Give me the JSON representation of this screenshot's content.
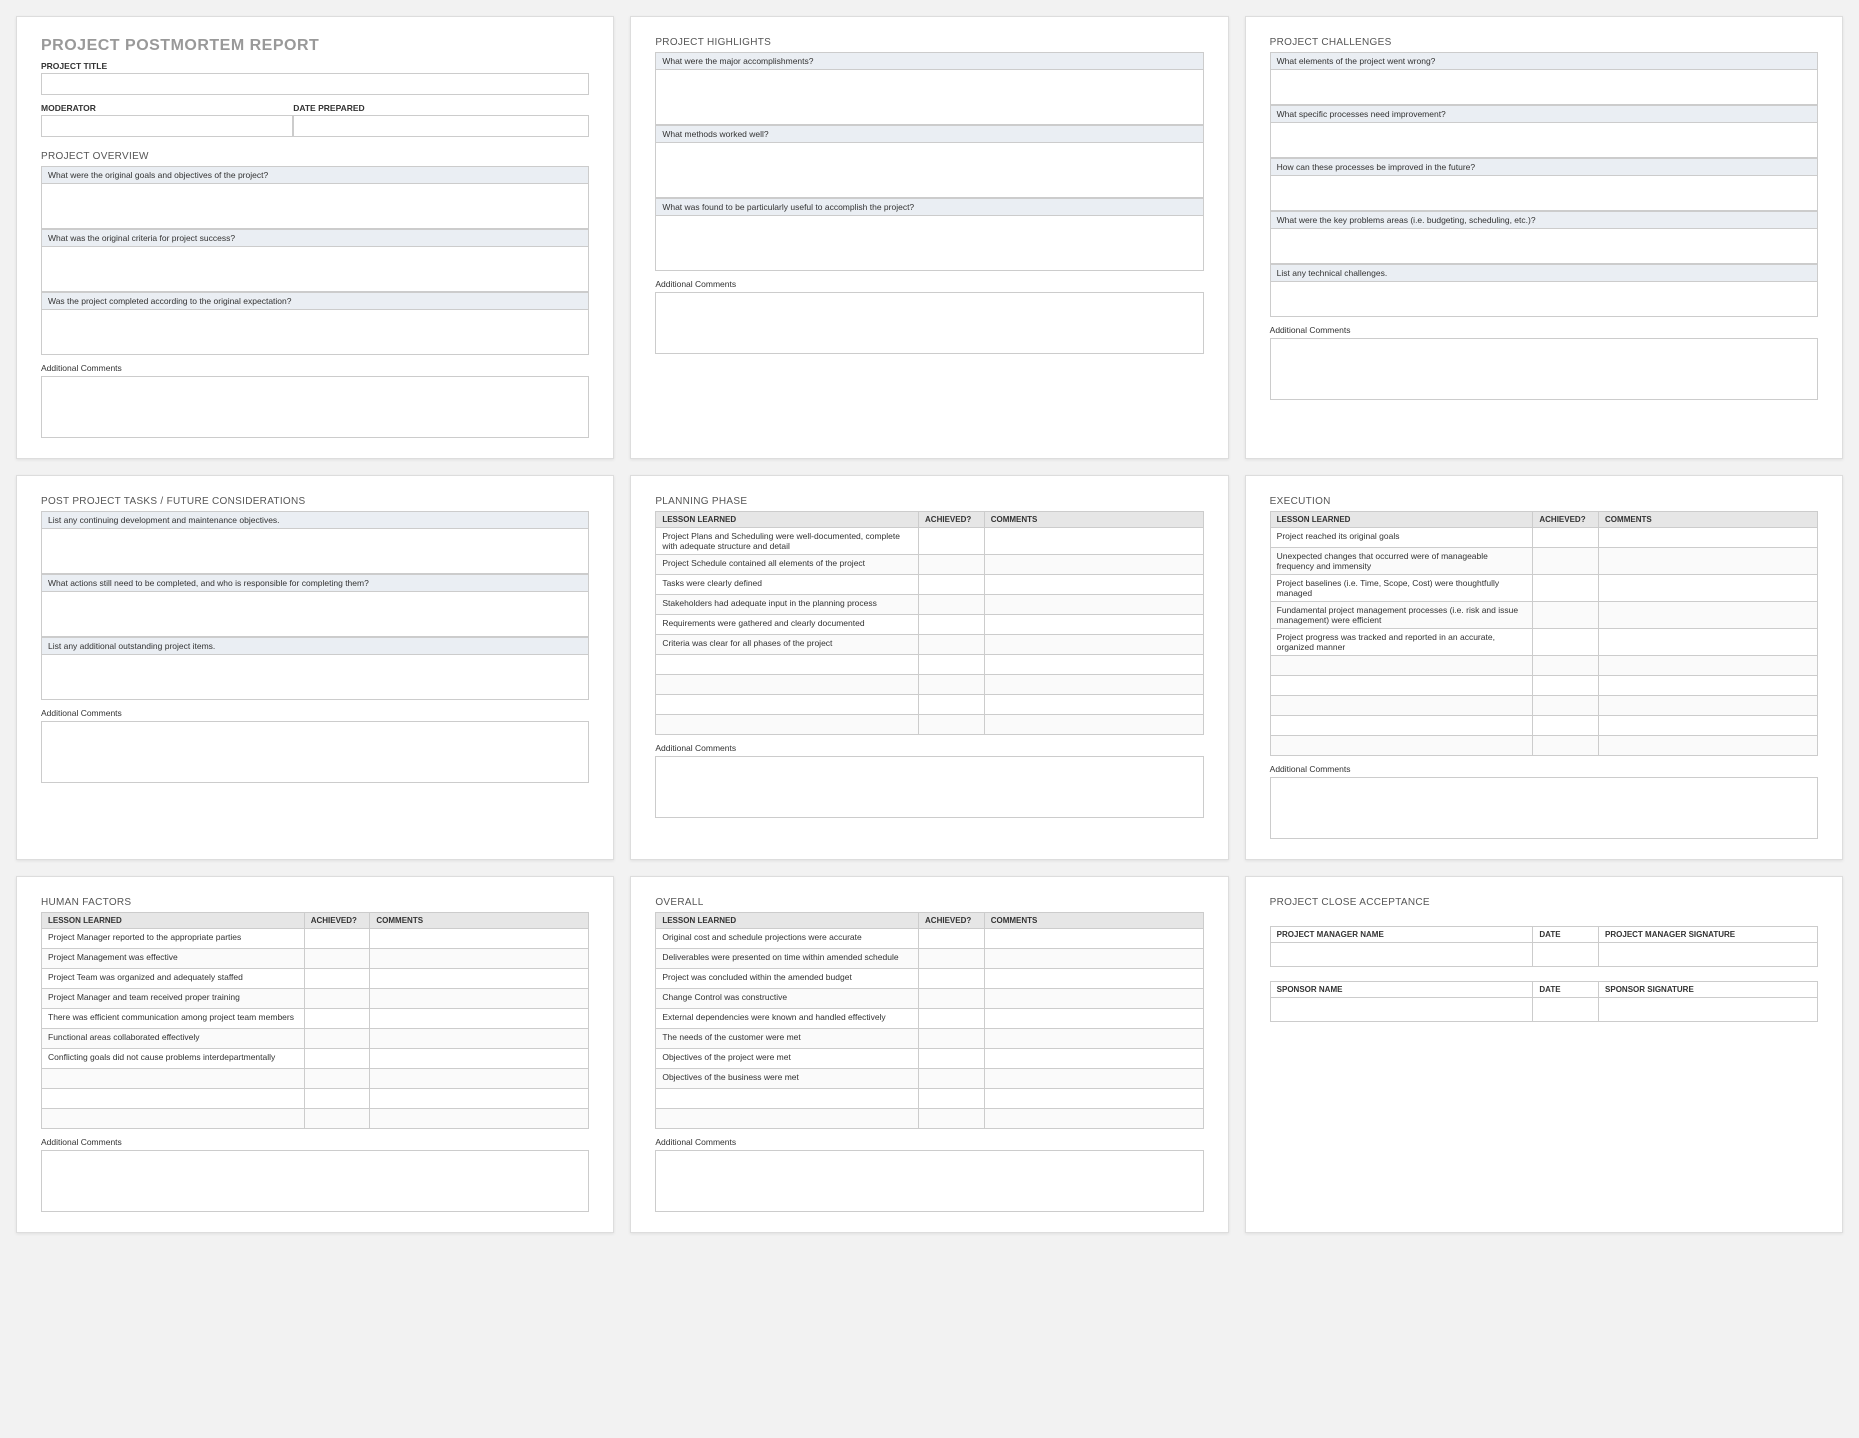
{
  "report": {
    "main_title": "PROJECT POSTMORTEM REPORT",
    "project_title_label": "PROJECT TITLE",
    "moderator_label": "MODERATOR",
    "date_prepared_label": "DATE PREPARED"
  },
  "overview": {
    "heading": "PROJECT OVERVIEW",
    "q1": "What were the original goals and objectives of the project?",
    "q2": "What was the original criteria for project success?",
    "q3": "Was the project completed according to the original expectation?",
    "comments_label": "Additional Comments"
  },
  "highlights": {
    "heading": "PROJECT HIGHLIGHTS",
    "q1": "What were the major accomplishments?",
    "q2": "What methods worked well?",
    "q3": "What was found to be particularly useful to accomplish the project?",
    "comments_label": "Additional Comments"
  },
  "challenges": {
    "heading": "PROJECT CHALLENGES",
    "q1": "What elements of the project went wrong?",
    "q2": "What specific processes need improvement?",
    "q3": "How can these processes be improved in the future?",
    "q4": "What were the key problems areas (i.e. budgeting, scheduling, etc.)?",
    "q5": "List any technical challenges.",
    "comments_label": "Additional Comments"
  },
  "postproject": {
    "heading": "POST PROJECT TASKS / FUTURE CONSIDERATIONS",
    "q1": "List any continuing development and maintenance objectives.",
    "q2": "What actions still need to be completed, and who is responsible for completing them?",
    "q3": "List any additional outstanding project items.",
    "comments_label": "Additional Comments"
  },
  "table_headers": {
    "lesson": "LESSON LEARNED",
    "achieved": "ACHIEVED?",
    "comments": "COMMENTS"
  },
  "planning": {
    "heading": "PLANNING PHASE",
    "rows": [
      "Project Plans and Scheduling were well-documented, complete with adequate structure and detail",
      "Project Schedule contained all elements of the project",
      "Tasks were clearly defined",
      "Stakeholders had adequate input in the planning process",
      "Requirements were gathered and clearly documented",
      "Criteria was clear for all phases of the project",
      "",
      "",
      "",
      ""
    ],
    "comments_label": "Additional Comments"
  },
  "execution": {
    "heading": "EXECUTION",
    "rows": [
      "Project reached its original goals",
      "Unexpected changes that occurred were of manageable frequency and immensity",
      "Project baselines (i.e. Time, Scope, Cost) were thoughtfully managed",
      "Fundamental project management processes (i.e. risk and issue management) were efficient",
      "Project progress was tracked and reported in an accurate, organized manner",
      "",
      "",
      "",
      "",
      ""
    ],
    "comments_label": "Additional Comments"
  },
  "human": {
    "heading": "HUMAN FACTORS",
    "rows": [
      "Project Manager reported to the appropriate parties",
      "Project Management was effective",
      "Project Team was organized and adequately staffed",
      "Project Manager and team received proper training",
      "There was efficient communication among project team members",
      "Functional areas collaborated effectively",
      "Conflicting goals did not cause problems interdepartmentally",
      "",
      "",
      ""
    ],
    "comments_label": "Additional Comments"
  },
  "overall": {
    "heading": "OVERALL",
    "rows": [
      "Original cost and schedule projections were accurate",
      "Deliverables were presented on time within amended schedule",
      "Project was concluded within the amended budget",
      "Change Control was constructive",
      "External dependencies were known and handled effectively",
      "The needs of the customer were met",
      "Objectives of the project were met",
      "Objectives of the business were met",
      "",
      ""
    ],
    "comments_label": "Additional Comments"
  },
  "acceptance": {
    "heading": "PROJECT CLOSE ACCEPTANCE",
    "pm_name": "PROJECT MANAGER NAME",
    "date": "DATE",
    "pm_sig": "PROJECT MANAGER SIGNATURE",
    "sponsor_name": "SPONSOR NAME",
    "sponsor_sig": "SPONSOR SIGNATURE"
  }
}
